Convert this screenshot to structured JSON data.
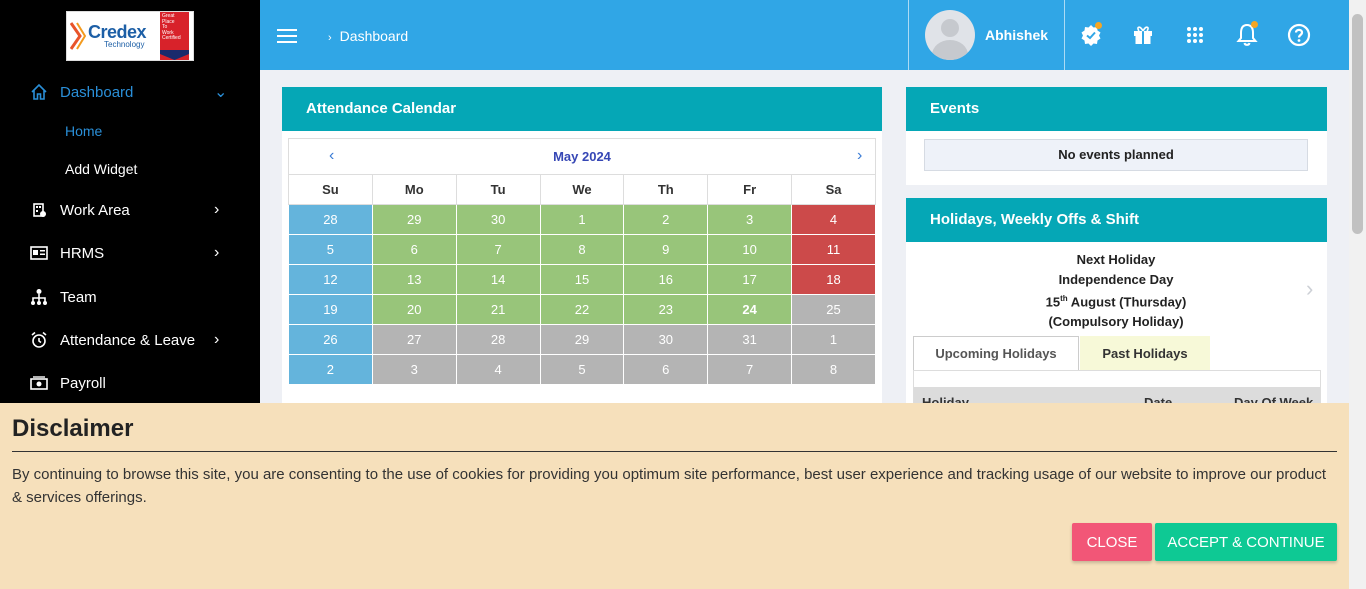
{
  "brand": {
    "name": "Credex",
    "tagline": "Technology",
    "badge": [
      "Great",
      "Place",
      "To",
      "Work",
      "Certified"
    ]
  },
  "sidebar": {
    "items": [
      {
        "label": "Dashboard",
        "icon": "home-icon",
        "chevron": "⌄",
        "active": true
      },
      {
        "label": "Work Area",
        "icon": "building-icon",
        "chevron": "›"
      },
      {
        "label": "HRMS",
        "icon": "id-card-icon",
        "chevron": "›"
      },
      {
        "label": "Team",
        "icon": "org-chart-icon",
        "chevron": ""
      },
      {
        "label": "Attendance & Leave",
        "icon": "alarm-clock-icon",
        "chevron": "›"
      },
      {
        "label": "Payroll",
        "icon": "money-icon",
        "chevron": ""
      }
    ],
    "subitems": [
      {
        "label": "Home",
        "active": true
      },
      {
        "label": "Add Widget",
        "active": false
      }
    ]
  },
  "topbar": {
    "breadcrumb_sep": "›",
    "breadcrumb": "Dashboard",
    "username": "Abhishek",
    "icons": [
      "badge-check-icon",
      "gift-icon",
      "apps-grid-icon",
      "bell-icon",
      "help-icon"
    ]
  },
  "attendance": {
    "title": "Attendance Calendar",
    "month": "May 2024",
    "prev": "‹",
    "next": "›",
    "weekdays": [
      "Su",
      "Mo",
      "Tu",
      "We",
      "Th",
      "Fr",
      "Sa"
    ],
    "weeks": [
      [
        {
          "d": "28",
          "s": "blue"
        },
        {
          "d": "29",
          "s": "green"
        },
        {
          "d": "30",
          "s": "green"
        },
        {
          "d": "1",
          "s": "green"
        },
        {
          "d": "2",
          "s": "green"
        },
        {
          "d": "3",
          "s": "green"
        },
        {
          "d": "4",
          "s": "red"
        }
      ],
      [
        {
          "d": "5",
          "s": "blue"
        },
        {
          "d": "6",
          "s": "green"
        },
        {
          "d": "7",
          "s": "green"
        },
        {
          "d": "8",
          "s": "green"
        },
        {
          "d": "9",
          "s": "green"
        },
        {
          "d": "10",
          "s": "green"
        },
        {
          "d": "11",
          "s": "red"
        }
      ],
      [
        {
          "d": "12",
          "s": "blue"
        },
        {
          "d": "13",
          "s": "green"
        },
        {
          "d": "14",
          "s": "green"
        },
        {
          "d": "15",
          "s": "green"
        },
        {
          "d": "16",
          "s": "green"
        },
        {
          "d": "17",
          "s": "green"
        },
        {
          "d": "18",
          "s": "red"
        }
      ],
      [
        {
          "d": "19",
          "s": "blue"
        },
        {
          "d": "20",
          "s": "green"
        },
        {
          "d": "21",
          "s": "green"
        },
        {
          "d": "22",
          "s": "green"
        },
        {
          "d": "23",
          "s": "green"
        },
        {
          "d": "24",
          "s": "green",
          "today": true
        },
        {
          "d": "25",
          "s": "grey"
        }
      ],
      [
        {
          "d": "26",
          "s": "blue"
        },
        {
          "d": "27",
          "s": "grey"
        },
        {
          "d": "28",
          "s": "grey"
        },
        {
          "d": "29",
          "s": "grey"
        },
        {
          "d": "30",
          "s": "grey"
        },
        {
          "d": "31",
          "s": "grey"
        },
        {
          "d": "1",
          "s": "grey"
        }
      ],
      [
        {
          "d": "2",
          "s": "blue"
        },
        {
          "d": "3",
          "s": "grey"
        },
        {
          "d": "4",
          "s": "grey"
        },
        {
          "d": "5",
          "s": "grey"
        },
        {
          "d": "6",
          "s": "grey"
        },
        {
          "d": "7",
          "s": "grey"
        },
        {
          "d": "8",
          "s": "grey"
        }
      ]
    ]
  },
  "events": {
    "title": "Events",
    "empty": "No events planned"
  },
  "holidays": {
    "title": "Holidays, Weekly Offs & Shift",
    "next_label": "Next Holiday",
    "next_name": "Independence Day",
    "next_day": "15",
    "next_day_suffix": "th",
    "next_date_rest": " August (Thursday)",
    "next_type": "(Compulsory Holiday)",
    "next_arrow": "›",
    "tabs": [
      "Upcoming Holidays",
      "Past Holidays"
    ],
    "columns": [
      "Holiday",
      "Date",
      "Day Of Week"
    ]
  },
  "disclaimer": {
    "title": "Disclaimer",
    "text": "By continuing to browse this site, you are consenting to the use of cookies for providing you optimum site performance, best user experience and tracking usage of our website to improve our product & services offerings.",
    "close": "CLOSE",
    "accept": "ACCEPT & CONTINUE"
  }
}
